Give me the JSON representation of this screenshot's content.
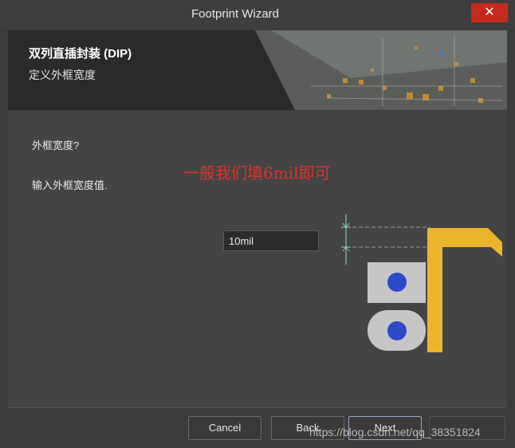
{
  "window": {
    "title": "Footprint Wizard",
    "close_glyph": "✕"
  },
  "header": {
    "title": "双列直插封装 (DIP)",
    "subtitle": "定义外框宽度"
  },
  "content": {
    "question": "外框宽度?",
    "annotation": "一般我们填6mil即可",
    "prompt": "输入外框宽度值.",
    "width_value": "10mil"
  },
  "footer": {
    "cancel_label": "Cancel",
    "back_label": "Back",
    "next_label": "Next",
    "watermark": "https://blog.csdn.net/qq_38351824"
  },
  "colors": {
    "accent_outline": "#e9b52a",
    "pad_fill": "#2b49c8",
    "annotation": "#e0312a"
  }
}
